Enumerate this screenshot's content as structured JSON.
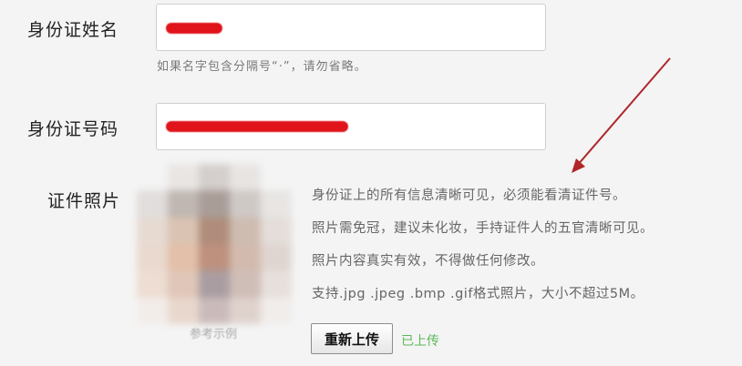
{
  "form": {
    "name": {
      "label": "身份证姓名",
      "hint": "如果名字包含分隔号“·”，请勿省略。"
    },
    "id_number": {
      "label": "身份证号码"
    },
    "photo": {
      "label": "证件照片",
      "caption": "参考示例",
      "notes": [
        "身份证上的所有信息清晰可见，必须能看清证件号。",
        "照片需免冠，建议未化妆，手持证件人的五官清晰可见。",
        "照片内容真实有效，不得做任何修改。",
        "支持.jpg .jpeg .bmp .gif格式照片，大小不超过5M。"
      ],
      "reupload_label": "重新上传",
      "status": "已上传"
    }
  },
  "colors": {
    "redaction": "#e0141a",
    "arrow": "#b0262a",
    "status": "#5cb85c"
  },
  "icons": {
    "annotation": "arrow-annotation"
  }
}
